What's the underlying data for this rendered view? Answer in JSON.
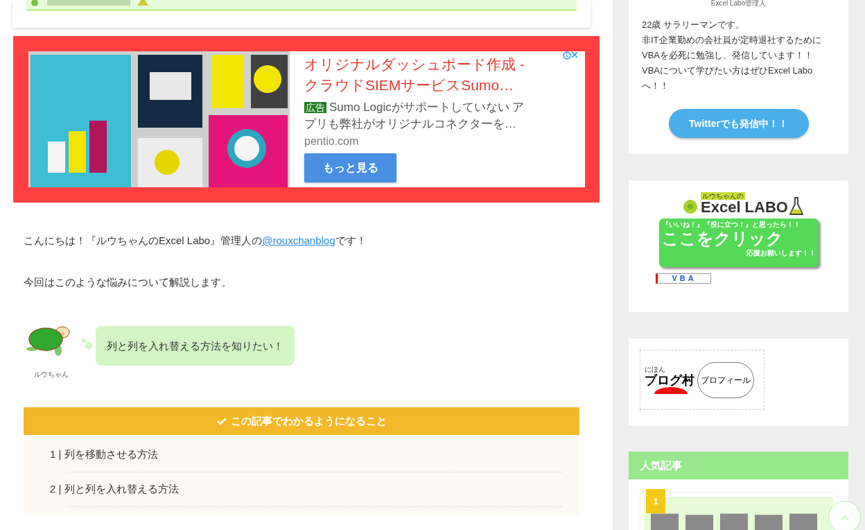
{
  "ad": {
    "title": "オリジナルダッシュボード作成 - クラウドSIEMサービスSumo…",
    "badge": "広告",
    "description": "Sumo Logicがサポートしていない アプリも弊社がオリジナルコネクターを…",
    "domain": "pentio.com",
    "button": "もっと見る"
  },
  "intro": {
    "before": "こんにちは！『ルウちゃんのExcel Labo』管理人の",
    "link": "@rouxchanblog",
    "after": "です！"
  },
  "lead": "今回はこのような悩みについて解説します。",
  "speech": {
    "name": "ルウちゃん",
    "text": "列と列を入れ替える方法を知りたい！"
  },
  "summary": {
    "title": "この記事でわかるようになること",
    "items": [
      {
        "number": "1 |",
        "text": "列を移動させる方法"
      },
      {
        "number": "2 |",
        "text": "列と列を入れ替える方法"
      }
    ]
  },
  "profile": {
    "role": "Excel Labo管理人",
    "bio_lines": [
      "22歳 サラリーマンです。",
      "非IT企業勤めの会社員が定時退社するために",
      "VBAを必死に勉強し、発信しています！！",
      "VBAについて学びたい方はぜひExcel Labo",
      "へ！！"
    ],
    "button": "Twitterでも発信中！！"
  },
  "banner": {
    "small_label": "ルウちゃんの",
    "logo": "Excel LABO",
    "top_line": "『いいね！』『役に立つ！』と思ったら！！",
    "cta": "ここをクリック",
    "bottom_line": "応援お願いします！！",
    "tag": "VBA"
  },
  "blogmura": {
    "small": "にほん",
    "logo": "ブログ村",
    "bubble": "プロフィール"
  },
  "popular": {
    "title": "人気記事",
    "items": [
      {
        "rank": "1"
      }
    ]
  }
}
